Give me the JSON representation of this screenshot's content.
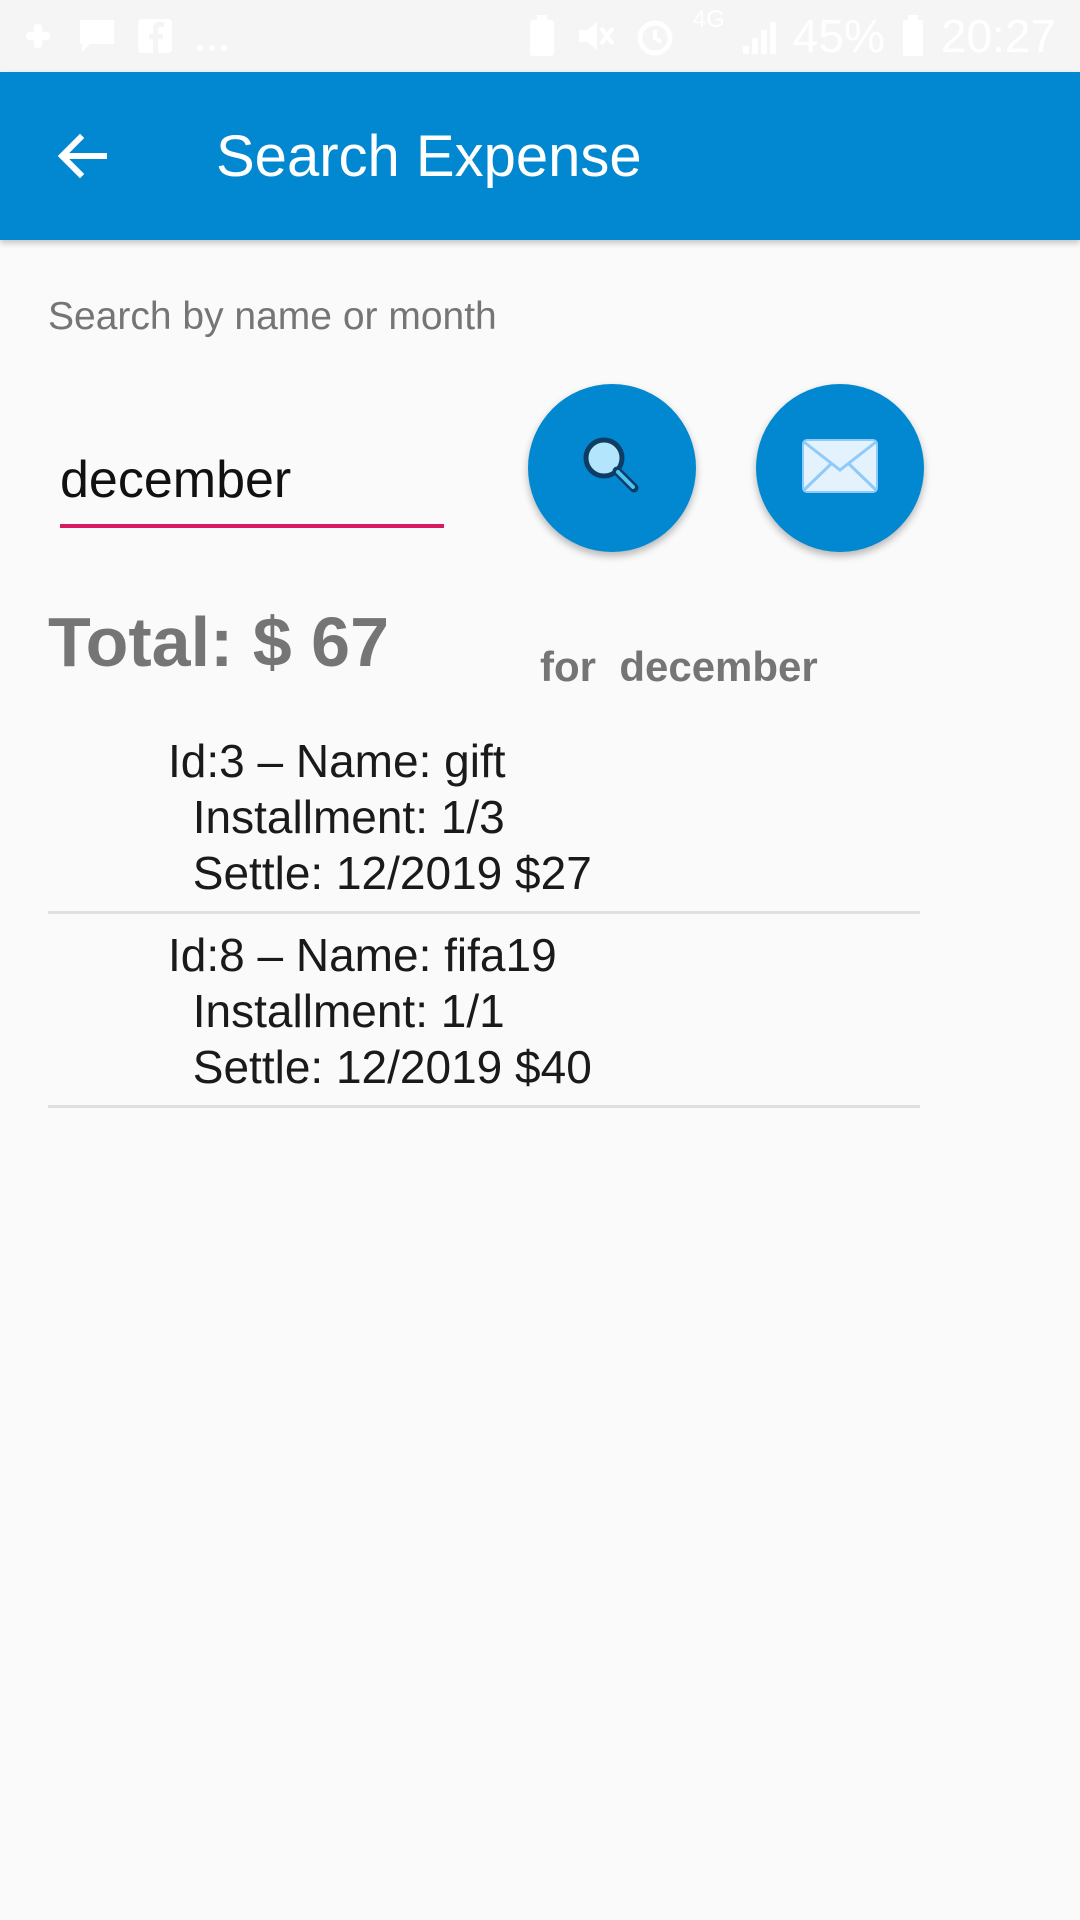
{
  "status_bar": {
    "battery_percent": "45%",
    "time": "20:27",
    "network": "4G",
    "left_icons": [
      "slack-icon",
      "message-icon",
      "facebook-icon",
      "more-dots-icon"
    ],
    "right_icons": [
      "battery-saver-icon",
      "mute-icon",
      "alarm-icon",
      "network-4g-icon",
      "signal-icon",
      "battery-icon"
    ]
  },
  "app_bar": {
    "title": "Search Expense",
    "back_icon": "arrow-left-icon",
    "background_color": "#0288d1"
  },
  "search": {
    "label": "Search by name or month",
    "value": "december",
    "underline_color": "#d81b60",
    "search_button_icon": "magnifier-icon",
    "email_button_icon": "envelope-icon"
  },
  "summary": {
    "total": "Total: $ 67",
    "for": "for  december"
  },
  "results": [
    {
      "line1": "Id:3 – Name: gift",
      "line2": " Installment: 1/3",
      "line3": " Settle: 12/2019 $27"
    },
    {
      "line1": "Id:8 – Name: fifa19",
      "line2": " Installment: 1/1",
      "line3": " Settle: 12/2019 $40"
    }
  ]
}
